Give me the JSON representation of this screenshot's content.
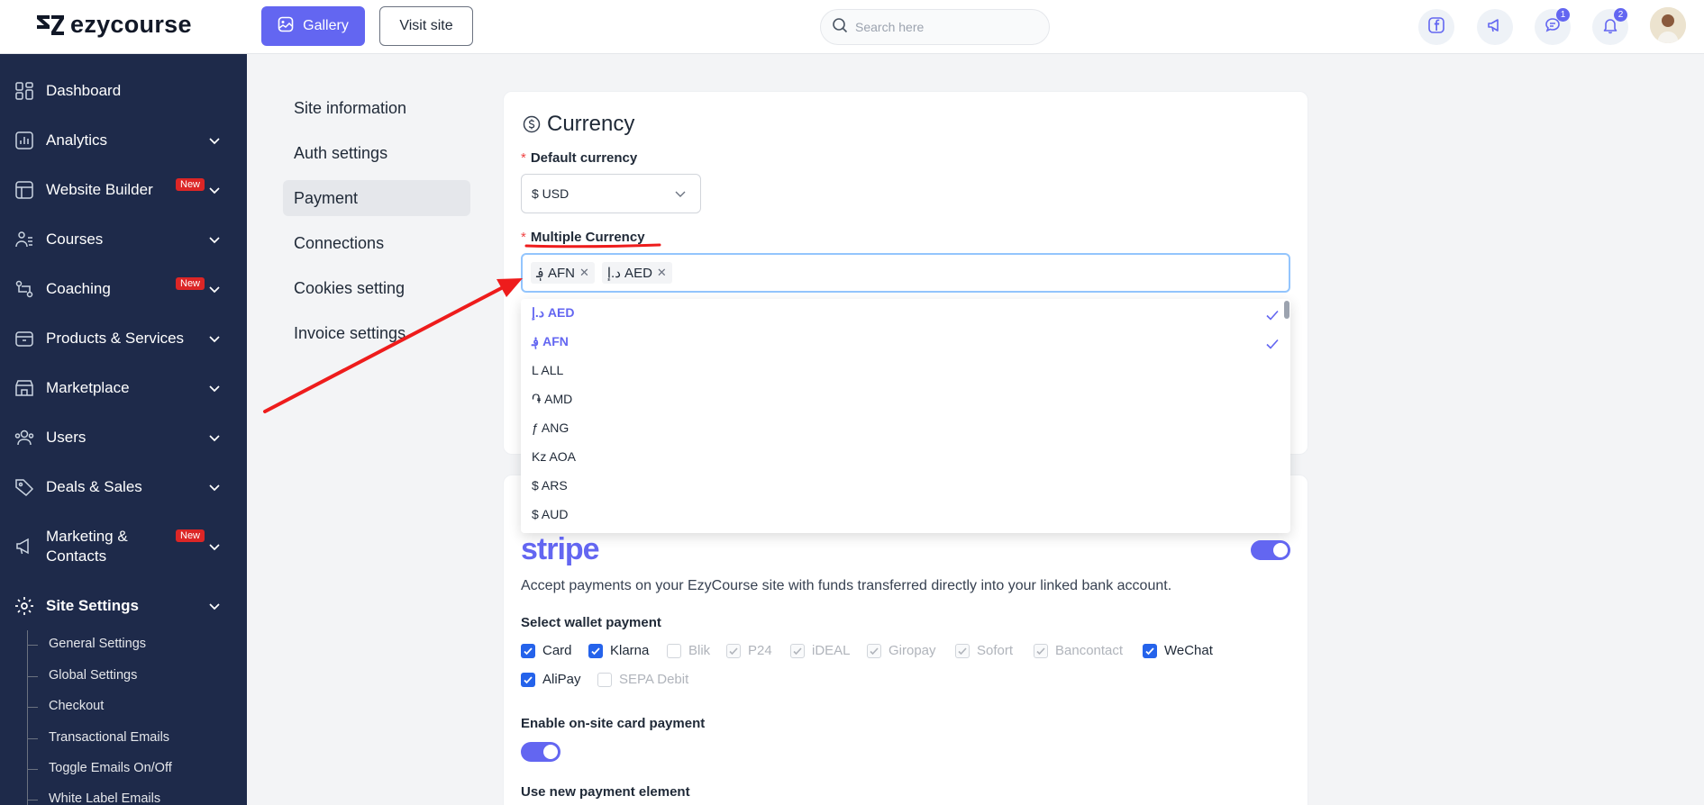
{
  "header": {
    "logo_text": "ezycourse",
    "gallery_label": "Gallery",
    "visit_label": "Visit site",
    "search_placeholder": "Search here",
    "messages_count": "1",
    "notifications_count": "2"
  },
  "sidebar": {
    "items": [
      {
        "label": "Dashboard",
        "icon": "dashboard-icon",
        "chevron": false,
        "new": false
      },
      {
        "label": "Analytics",
        "icon": "analytics-icon",
        "chevron": true,
        "new": false
      },
      {
        "label": "Website Builder",
        "icon": "website-builder-icon",
        "chevron": true,
        "new": true
      },
      {
        "label": "Courses",
        "icon": "courses-icon",
        "chevron": true,
        "new": false
      },
      {
        "label": "Coaching",
        "icon": "coaching-icon",
        "chevron": true,
        "new": true
      },
      {
        "label": "Products & Services",
        "icon": "products-icon",
        "chevron": true,
        "new": false
      },
      {
        "label": "Marketplace",
        "icon": "marketplace-icon",
        "chevron": true,
        "new": false
      },
      {
        "label": "Users",
        "icon": "users-icon",
        "chevron": true,
        "new": false
      },
      {
        "label": "Deals & Sales",
        "icon": "deals-icon",
        "chevron": true,
        "new": false
      },
      {
        "label": "Marketing &",
        "label2": "Contacts",
        "icon": "marketing-icon",
        "chevron": true,
        "new": true
      },
      {
        "label": "Site Settings",
        "icon": "site-settings-icon",
        "chevron": true,
        "new": false
      }
    ],
    "new_badge": "New",
    "sub_items": [
      "General Settings",
      "Global Settings",
      "Checkout",
      "Transactional Emails",
      "Toggle Emails On/Off",
      "White Label Emails"
    ]
  },
  "settings_nav": {
    "items": [
      "Site information",
      "Auth settings",
      "Payment",
      "Connections",
      "Cookies setting",
      "Invoice settings"
    ],
    "active": "Payment"
  },
  "currency": {
    "title": "Currency",
    "default_label": "Default currency",
    "default_value": "$ USD",
    "multiple_label": "Multiple Currency",
    "tags": [
      "؋ AFN",
      "د.إ AED"
    ],
    "options": [
      {
        "label": "د.إ AED",
        "selected": true
      },
      {
        "label": "؋ AFN",
        "selected": true
      },
      {
        "label": "L ALL",
        "selected": false
      },
      {
        "label": "֏ AMD",
        "selected": false
      },
      {
        "label": "ƒ ANG",
        "selected": false
      },
      {
        "label": "Kz AOA",
        "selected": false
      },
      {
        "label": "$ ARS",
        "selected": false
      },
      {
        "label": "$ AUD",
        "selected": false
      }
    ]
  },
  "stripe": {
    "logo": "stripe",
    "enabled": true,
    "description": "Accept payments on your EzyCourse site with funds transferred directly into your linked bank account.",
    "wallet_label": "Select wallet payment",
    "wallets": [
      {
        "label": "Card",
        "state": "on"
      },
      {
        "label": "Klarna",
        "state": "on"
      },
      {
        "label": "Blik",
        "state": "off"
      },
      {
        "label": "P24",
        "state": "dis"
      },
      {
        "label": "iDEAL",
        "state": "dis"
      },
      {
        "label": "Giropay",
        "state": "dis"
      },
      {
        "label": "Sofort",
        "state": "dis"
      },
      {
        "label": "Bancontact",
        "state": "dis"
      },
      {
        "label": "WeChat",
        "state": "on"
      },
      {
        "label": "AliPay",
        "state": "on"
      },
      {
        "label": "SEPA Debit",
        "state": "off"
      }
    ],
    "onsite_label": "Enable on-site card payment",
    "onsite_enabled": true,
    "new_element_label": "Use new payment element"
  },
  "colors": {
    "accent": "#6366f1",
    "sidebar": "#1e2a4a",
    "annotation": "#ee1c1c",
    "checkbox": "#2563eb"
  }
}
